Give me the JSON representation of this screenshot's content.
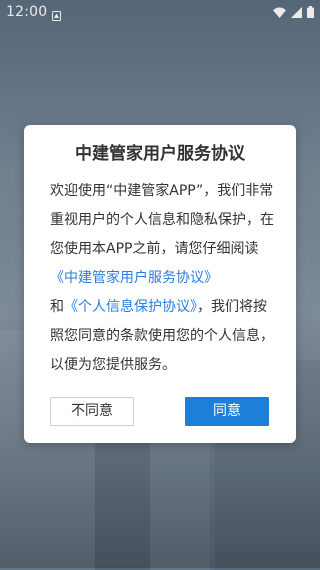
{
  "status_bar": {
    "time": "12:00",
    "icons": [
      "notification-icon",
      "wifi-icon",
      "signal-icon",
      "battery-icon"
    ]
  },
  "dialog": {
    "title": "中建管家用户服务协议",
    "body": {
      "text_1": "欢迎使用“中建管家APP”，我们非常重视用户的个人信息和隐私保护，在您使用本APP之前，请您仔细阅读",
      "link_service": "《中建管家用户服务协议》",
      "text_2": "和",
      "link_privacy": "《个人信息保护协议》",
      "text_3": "，我们将按照您同意的条款使用您的个人信息，以便为您提供服务。"
    },
    "decline_label": "不同意",
    "agree_label": "同意"
  },
  "colors": {
    "link": "#2b7de1",
    "primary_button": "#1e7fd9",
    "title_text": "#333333"
  }
}
